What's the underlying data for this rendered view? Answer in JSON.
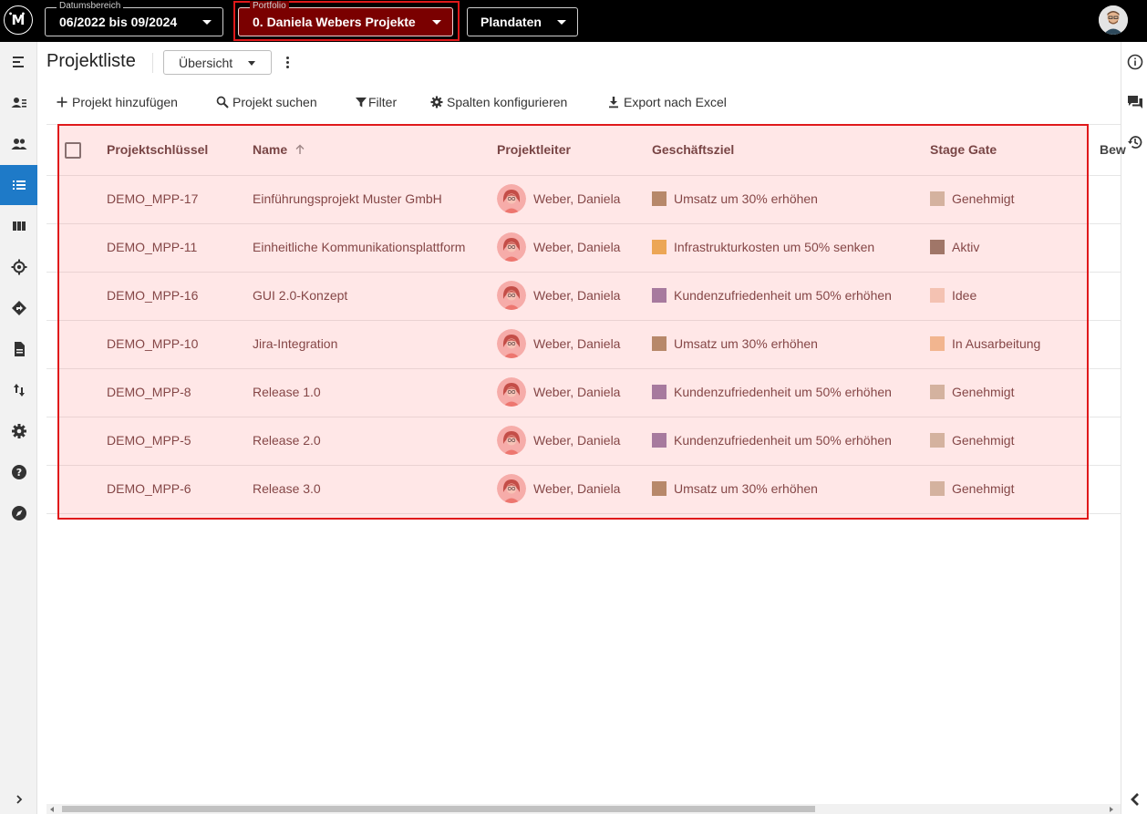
{
  "topbar": {
    "date_range": {
      "legend": "Datumsbereich",
      "value": "06/2022 bis 09/2024"
    },
    "portfolio": {
      "legend": "Portfolio",
      "value": "0. Daniela Webers Projekte"
    },
    "plan": {
      "value": "Plandaten"
    }
  },
  "header": {
    "title": "Projektliste",
    "view": "Übersicht"
  },
  "toolbar": {
    "add": "Projekt hinzufügen",
    "search": "Projekt suchen",
    "filter": "Filter",
    "columns": "Spalten konfigurieren",
    "export": "Export nach Excel"
  },
  "table": {
    "columns": {
      "key": "Projektschlüssel",
      "name": "Name",
      "leader": "Projektleiter",
      "goal": "Geschäftsziel",
      "stage": "Stage Gate",
      "extra": "Bew"
    },
    "rows": [
      {
        "key": "DEMO_MPP-17",
        "name": "Einführungsprojekt Muster GmbH",
        "leader": "Weber, Daniela",
        "goal": "Umsatz um 30% erhöhen",
        "goal_color": "#a88c67",
        "stage": "Genehmigt",
        "stage_color": "#cbbfa8"
      },
      {
        "key": "DEMO_MPP-11",
        "name": "Einheitliche Kommunikationsplattform",
        "leader": "Weber, Daniela",
        "goal": "Infrastrukturkosten um 50% senken",
        "goal_color": "#e8b04f",
        "stage": "Aktiv",
        "stage_color": "#8c7664"
      },
      {
        "key": "DEMO_MPP-16",
        "name": "GUI 2.0-Konzept",
        "leader": "Weber, Daniela",
        "goal": "Kundenzufriedenheit um 50% erhöhen",
        "goal_color": "#947aa6",
        "stage": "Idee",
        "stage_color": "#f2d2bf"
      },
      {
        "key": "DEMO_MPP-10",
        "name": "Jira-Integration",
        "leader": "Weber, Daniela",
        "goal": "Umsatz um 30% erhöhen",
        "goal_color": "#a88c67",
        "stage": "In Ausarbeitung",
        "stage_color": "#f0c394"
      },
      {
        "key": "DEMO_MPP-8",
        "name": "Release 1.0",
        "leader": "Weber, Daniela",
        "goal": "Kundenzufriedenheit um 50% erhöhen",
        "goal_color": "#947aa6",
        "stage": "Genehmigt",
        "stage_color": "#cbbfa8"
      },
      {
        "key": "DEMO_MPP-5",
        "name": "Release 2.0",
        "leader": "Weber, Daniela",
        "goal": "Kundenzufriedenheit um 50% erhöhen",
        "goal_color": "#947aa6",
        "stage": "Genehmigt",
        "stage_color": "#cbbfa8"
      },
      {
        "key": "DEMO_MPP-6",
        "name": "Release 3.0",
        "leader": "Weber, Daniela",
        "goal": "Umsatz um 30% erhöhen",
        "goal_color": "#a88c67",
        "stage": "Genehmigt",
        "stage_color": "#cbbfa8"
      }
    ]
  },
  "colors": {
    "active_nav": "#1e7ac8",
    "highlight": "#e0191b"
  }
}
